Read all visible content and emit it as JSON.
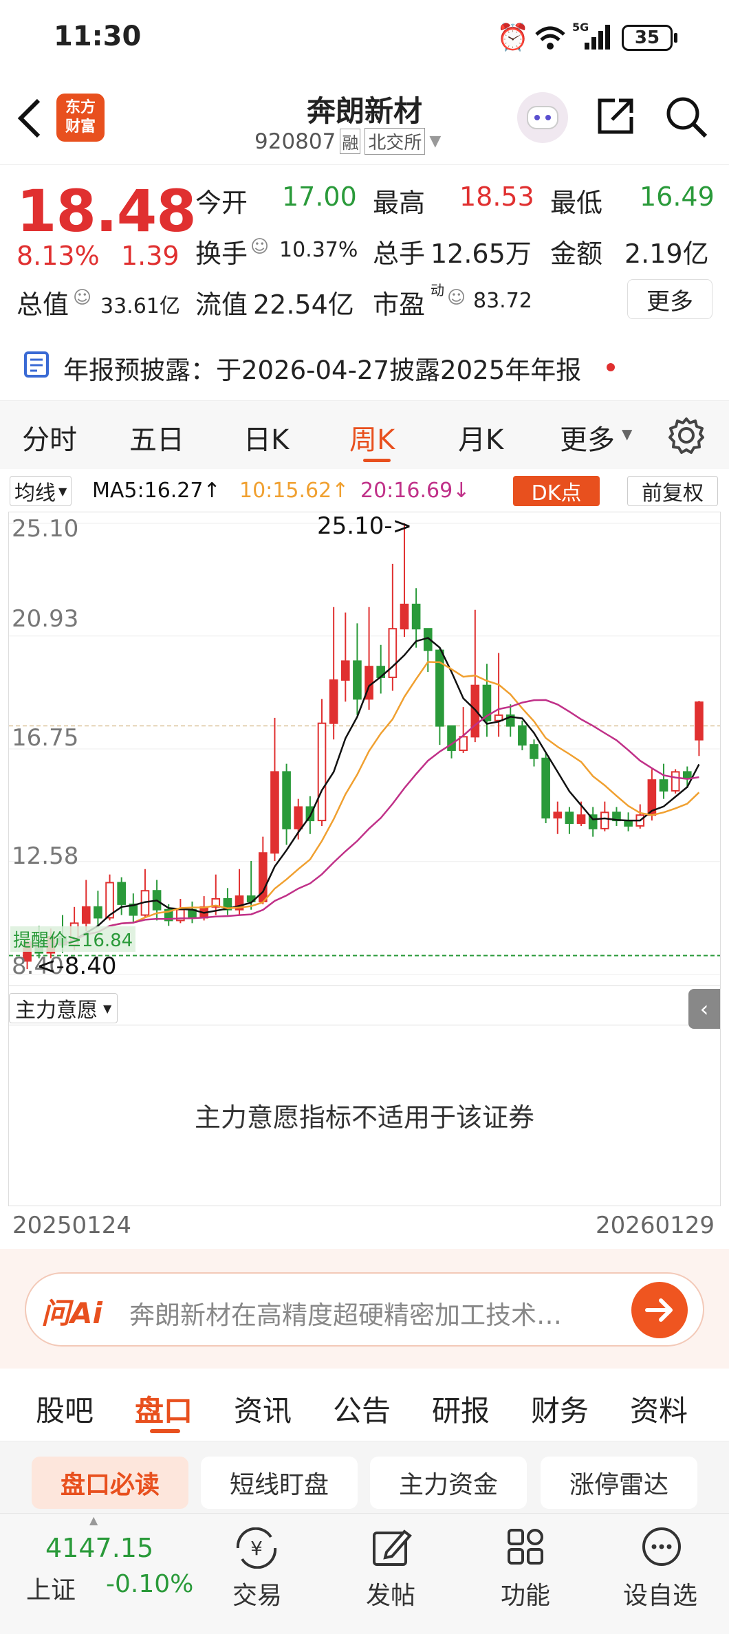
{
  "status_bar": {
    "time": "11:30",
    "network": "5G",
    "battery": "35"
  },
  "header": {
    "logo_line1": "东方",
    "logo_line2": "财富",
    "title": "奔朗新材",
    "code": "920807",
    "tag_rong": "融",
    "tag_exchange": "北交所"
  },
  "quote": {
    "price": "18.48",
    "change_pct": "8.13%",
    "change": "1.39",
    "open_label": "今开",
    "open": "17.00",
    "high_label": "最高",
    "high": "18.53",
    "low_label": "最低",
    "low": "16.49",
    "turnover_label": "换手",
    "turnover": "10.37%",
    "volume_label": "总手",
    "volume": "12.65万",
    "amount_label": "金额",
    "amount": "2.19亿",
    "mktcap_label": "总值",
    "mktcap": "33.61亿",
    "float_label": "流值",
    "float": "22.54亿",
    "pe_label": "市盈",
    "pe_sup": "动",
    "pe": "83.72",
    "more_label": "更多"
  },
  "notice": {
    "text": "年报预披露：于2026-04-27披露2025年年报"
  },
  "chart_tabs": [
    "分时",
    "五日",
    "日K",
    "周K",
    "月K",
    "更多"
  ],
  "active_chart_tab": "周K",
  "ma_bar": {
    "selector": "均线",
    "ma5": "MA5:16.27↑",
    "ma10": "10:15.62↑",
    "ma20": "20:16.69↓",
    "dk_label": "DK点",
    "adjust_label": "前复权"
  },
  "axis": {
    "y_labels": [
      "25.10",
      "20.93",
      "16.75",
      "12.58",
      "8.40"
    ],
    "max_note": "25.10->",
    "min_note": "<-8.40",
    "alert_label": "提醒价≥16.84"
  },
  "indicator": {
    "selector": "主力意愿",
    "message": "主力意愿指标不适用于该证券"
  },
  "dates": {
    "start": "20250124",
    "end": "20260129"
  },
  "ai": {
    "label": "问Ai",
    "text": "奔朗新材在高精度超硬精密加工技术…"
  },
  "feature_tabs": [
    "股吧",
    "盘口",
    "资讯",
    "公告",
    "研报",
    "财务",
    "资料"
  ],
  "active_feature_tab": "盘口",
  "sub_tabs": [
    "盘口必读",
    "短线盯盘",
    "主力资金",
    "涨停雷达"
  ],
  "bottom": {
    "index_value": "4147.15",
    "index_name": "上证",
    "index_change": "-0.10%",
    "trade": "交易",
    "post": "发帖",
    "func": "功能",
    "watch": "设自选"
  },
  "colors": {
    "up": "#e03030",
    "down": "#2a9a3a",
    "accent": "#e8501e",
    "ma5": "#111111",
    "ma10": "#f0a030",
    "ma20": "#c03088"
  },
  "chart_data": {
    "type": "candlestick",
    "ylim": [
      8.4,
      25.1
    ],
    "candles": [
      [
        8.9,
        9.6,
        8.6,
        9.8
      ],
      [
        9.6,
        9.2,
        9.0,
        10.2
      ],
      [
        9.2,
        9.8,
        9.0,
        10.1
      ],
      [
        9.8,
        9.5,
        9.2,
        10.6
      ],
      [
        9.5,
        10.3,
        9.3,
        10.9
      ],
      [
        10.3,
        10.9,
        10.0,
        11.9
      ],
      [
        10.9,
        10.5,
        10.2,
        11.5
      ],
      [
        10.5,
        11.8,
        10.4,
        12.1
      ],
      [
        11.8,
        11.0,
        10.6,
        12.0
      ],
      [
        11.0,
        10.6,
        10.3,
        11.4
      ],
      [
        10.6,
        11.5,
        10.5,
        12.3
      ],
      [
        11.5,
        10.8,
        10.4,
        11.9
      ],
      [
        10.8,
        10.4,
        10.2,
        11.0
      ],
      [
        10.4,
        10.8,
        10.3,
        11.2
      ],
      [
        10.8,
        10.5,
        10.3,
        11.1
      ],
      [
        10.5,
        10.9,
        10.4,
        11.3
      ],
      [
        10.9,
        11.2,
        10.6,
        12.1
      ],
      [
        11.2,
        10.8,
        10.6,
        11.6
      ],
      [
        10.8,
        11.3,
        10.6,
        12.3
      ],
      [
        11.3,
        11.1,
        10.8,
        12.6
      ],
      [
        11.1,
        12.9,
        11.0,
        13.5
      ],
      [
        12.9,
        15.9,
        12.6,
        17.9
      ],
      [
        15.9,
        13.8,
        13.2,
        16.2
      ],
      [
        13.8,
        14.6,
        13.4,
        14.9
      ],
      [
        14.6,
        14.1,
        13.6,
        15.0
      ],
      [
        14.1,
        17.7,
        13.9,
        18.6
      ],
      [
        17.7,
        19.3,
        17.1,
        22.0
      ],
      [
        19.3,
        20.0,
        18.5,
        21.8
      ],
      [
        20.0,
        18.6,
        18.0,
        21.4
      ],
      [
        18.6,
        19.8,
        18.2,
        22.0
      ],
      [
        19.8,
        19.4,
        18.8,
        20.6
      ],
      [
        19.4,
        21.2,
        18.9,
        23.6
      ],
      [
        21.2,
        22.1,
        20.9,
        25.1
      ],
      [
        22.1,
        21.2,
        20.5,
        22.7
      ],
      [
        21.2,
        20.4,
        19.6,
        20.9
      ],
      [
        20.4,
        17.6,
        16.9,
        20.5
      ],
      [
        17.6,
        16.7,
        16.4,
        17.4
      ],
      [
        16.7,
        17.2,
        16.6,
        18.3
      ],
      [
        17.2,
        19.1,
        17.0,
        21.9
      ],
      [
        19.1,
        17.8,
        17.2,
        19.9
      ],
      [
        17.8,
        18.0,
        17.2,
        20.3
      ],
      [
        18.0,
        17.6,
        17.2,
        18.4
      ],
      [
        17.6,
        16.9,
        16.7,
        17.8
      ],
      [
        16.9,
        16.4,
        16.1,
        17.1
      ],
      [
        16.4,
        14.2,
        14.0,
        16.6
      ],
      [
        14.2,
        14.4,
        13.6,
        14.8
      ],
      [
        14.4,
        14.0,
        13.6,
        14.6
      ],
      [
        14.0,
        14.3,
        13.9,
        14.8
      ],
      [
        14.3,
        13.8,
        13.5,
        14.6
      ],
      [
        13.8,
        14.4,
        13.7,
        14.8
      ],
      [
        14.4,
        14.1,
        13.9,
        14.6
      ],
      [
        14.1,
        13.9,
        13.7,
        14.4
      ],
      [
        13.9,
        14.3,
        13.8,
        14.7
      ],
      [
        14.3,
        15.6,
        14.1,
        16.0
      ],
      [
        15.6,
        15.2,
        14.9,
        16.2
      ],
      [
        15.2,
        15.9,
        15.1,
        16.0
      ],
      [
        15.9,
        15.7,
        15.3,
        16.1
      ],
      [
        17.09,
        18.48,
        16.49,
        18.53
      ]
    ]
  }
}
